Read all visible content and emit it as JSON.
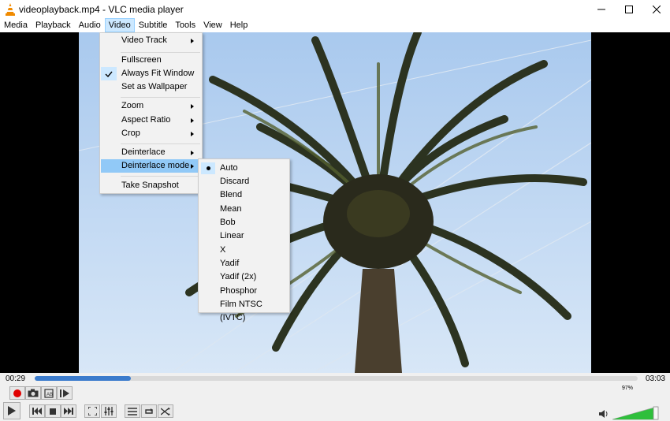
{
  "window": {
    "title": "videoplayback.mp4 - VLC media player",
    "buttons": [
      "minimize",
      "maximize",
      "close"
    ]
  },
  "menubar": {
    "items": [
      "Media",
      "Playback",
      "Audio",
      "Video",
      "Subtitle",
      "Tools",
      "View",
      "Help"
    ],
    "active": "Video"
  },
  "video_menu": {
    "items": {
      "video_track": "Video Track",
      "fullscreen": "Fullscreen",
      "always_fit": "Always Fit Window",
      "wallpaper": "Set as Wallpaper",
      "zoom": "Zoom",
      "aspect": "Aspect Ratio",
      "crop": "Crop",
      "deinterlace": "Deinterlace",
      "deinterlace_mode": "Deinterlace mode",
      "snapshot": "Take Snapshot"
    },
    "checked": "Always Fit Window",
    "highlighted": "Deinterlace mode"
  },
  "deinterlace_submenu": {
    "items": [
      "Auto",
      "Discard",
      "Blend",
      "Mean",
      "Bob",
      "Linear",
      "X",
      "Yadif",
      "Yadif (2x)",
      "Phosphor",
      "Film NTSC (IVTC)"
    ],
    "selected": "Auto"
  },
  "playback": {
    "elapsed": "00:29",
    "total": "03:03",
    "progress_fraction": 0.16,
    "volume_label": "97%",
    "volume_fraction": 0.97
  },
  "colors": {
    "accent": "#3b7bcc",
    "menu_highlight": "#91c9f7",
    "record": "#e00000",
    "volume": "#2fbf3c",
    "sky": "#b9d4f0"
  }
}
